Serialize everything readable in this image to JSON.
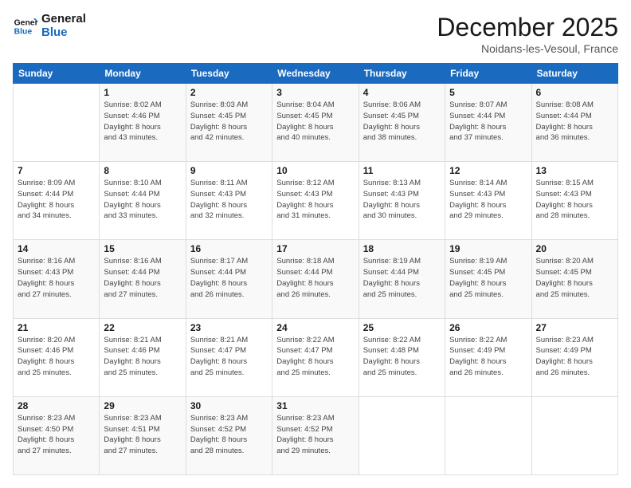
{
  "logo": {
    "text_general": "General",
    "text_blue": "Blue"
  },
  "header": {
    "month_title": "December 2025",
    "subtitle": "Noidans-les-Vesoul, France"
  },
  "days_of_week": [
    "Sunday",
    "Monday",
    "Tuesday",
    "Wednesday",
    "Thursday",
    "Friday",
    "Saturday"
  ],
  "weeks": [
    [
      {
        "day": "",
        "info": ""
      },
      {
        "day": "1",
        "info": "Sunrise: 8:02 AM\nSunset: 4:46 PM\nDaylight: 8 hours\nand 43 minutes."
      },
      {
        "day": "2",
        "info": "Sunrise: 8:03 AM\nSunset: 4:45 PM\nDaylight: 8 hours\nand 42 minutes."
      },
      {
        "day": "3",
        "info": "Sunrise: 8:04 AM\nSunset: 4:45 PM\nDaylight: 8 hours\nand 40 minutes."
      },
      {
        "day": "4",
        "info": "Sunrise: 8:06 AM\nSunset: 4:45 PM\nDaylight: 8 hours\nand 38 minutes."
      },
      {
        "day": "5",
        "info": "Sunrise: 8:07 AM\nSunset: 4:44 PM\nDaylight: 8 hours\nand 37 minutes."
      },
      {
        "day": "6",
        "info": "Sunrise: 8:08 AM\nSunset: 4:44 PM\nDaylight: 8 hours\nand 36 minutes."
      }
    ],
    [
      {
        "day": "7",
        "info": "Sunrise: 8:09 AM\nSunset: 4:44 PM\nDaylight: 8 hours\nand 34 minutes."
      },
      {
        "day": "8",
        "info": "Sunrise: 8:10 AM\nSunset: 4:44 PM\nDaylight: 8 hours\nand 33 minutes."
      },
      {
        "day": "9",
        "info": "Sunrise: 8:11 AM\nSunset: 4:43 PM\nDaylight: 8 hours\nand 32 minutes."
      },
      {
        "day": "10",
        "info": "Sunrise: 8:12 AM\nSunset: 4:43 PM\nDaylight: 8 hours\nand 31 minutes."
      },
      {
        "day": "11",
        "info": "Sunrise: 8:13 AM\nSunset: 4:43 PM\nDaylight: 8 hours\nand 30 minutes."
      },
      {
        "day": "12",
        "info": "Sunrise: 8:14 AM\nSunset: 4:43 PM\nDaylight: 8 hours\nand 29 minutes."
      },
      {
        "day": "13",
        "info": "Sunrise: 8:15 AM\nSunset: 4:43 PM\nDaylight: 8 hours\nand 28 minutes."
      }
    ],
    [
      {
        "day": "14",
        "info": "Sunrise: 8:16 AM\nSunset: 4:43 PM\nDaylight: 8 hours\nand 27 minutes."
      },
      {
        "day": "15",
        "info": "Sunrise: 8:16 AM\nSunset: 4:44 PM\nDaylight: 8 hours\nand 27 minutes."
      },
      {
        "day": "16",
        "info": "Sunrise: 8:17 AM\nSunset: 4:44 PM\nDaylight: 8 hours\nand 26 minutes."
      },
      {
        "day": "17",
        "info": "Sunrise: 8:18 AM\nSunset: 4:44 PM\nDaylight: 8 hours\nand 26 minutes."
      },
      {
        "day": "18",
        "info": "Sunrise: 8:19 AM\nSunset: 4:44 PM\nDaylight: 8 hours\nand 25 minutes."
      },
      {
        "day": "19",
        "info": "Sunrise: 8:19 AM\nSunset: 4:45 PM\nDaylight: 8 hours\nand 25 minutes."
      },
      {
        "day": "20",
        "info": "Sunrise: 8:20 AM\nSunset: 4:45 PM\nDaylight: 8 hours\nand 25 minutes."
      }
    ],
    [
      {
        "day": "21",
        "info": "Sunrise: 8:20 AM\nSunset: 4:46 PM\nDaylight: 8 hours\nand 25 minutes."
      },
      {
        "day": "22",
        "info": "Sunrise: 8:21 AM\nSunset: 4:46 PM\nDaylight: 8 hours\nand 25 minutes."
      },
      {
        "day": "23",
        "info": "Sunrise: 8:21 AM\nSunset: 4:47 PM\nDaylight: 8 hours\nand 25 minutes."
      },
      {
        "day": "24",
        "info": "Sunrise: 8:22 AM\nSunset: 4:47 PM\nDaylight: 8 hours\nand 25 minutes."
      },
      {
        "day": "25",
        "info": "Sunrise: 8:22 AM\nSunset: 4:48 PM\nDaylight: 8 hours\nand 25 minutes."
      },
      {
        "day": "26",
        "info": "Sunrise: 8:22 AM\nSunset: 4:49 PM\nDaylight: 8 hours\nand 26 minutes."
      },
      {
        "day": "27",
        "info": "Sunrise: 8:23 AM\nSunset: 4:49 PM\nDaylight: 8 hours\nand 26 minutes."
      }
    ],
    [
      {
        "day": "28",
        "info": "Sunrise: 8:23 AM\nSunset: 4:50 PM\nDaylight: 8 hours\nand 27 minutes."
      },
      {
        "day": "29",
        "info": "Sunrise: 8:23 AM\nSunset: 4:51 PM\nDaylight: 8 hours\nand 27 minutes."
      },
      {
        "day": "30",
        "info": "Sunrise: 8:23 AM\nSunset: 4:52 PM\nDaylight: 8 hours\nand 28 minutes."
      },
      {
        "day": "31",
        "info": "Sunrise: 8:23 AM\nSunset: 4:52 PM\nDaylight: 8 hours\nand 29 minutes."
      },
      {
        "day": "",
        "info": ""
      },
      {
        "day": "",
        "info": ""
      },
      {
        "day": "",
        "info": ""
      }
    ]
  ]
}
